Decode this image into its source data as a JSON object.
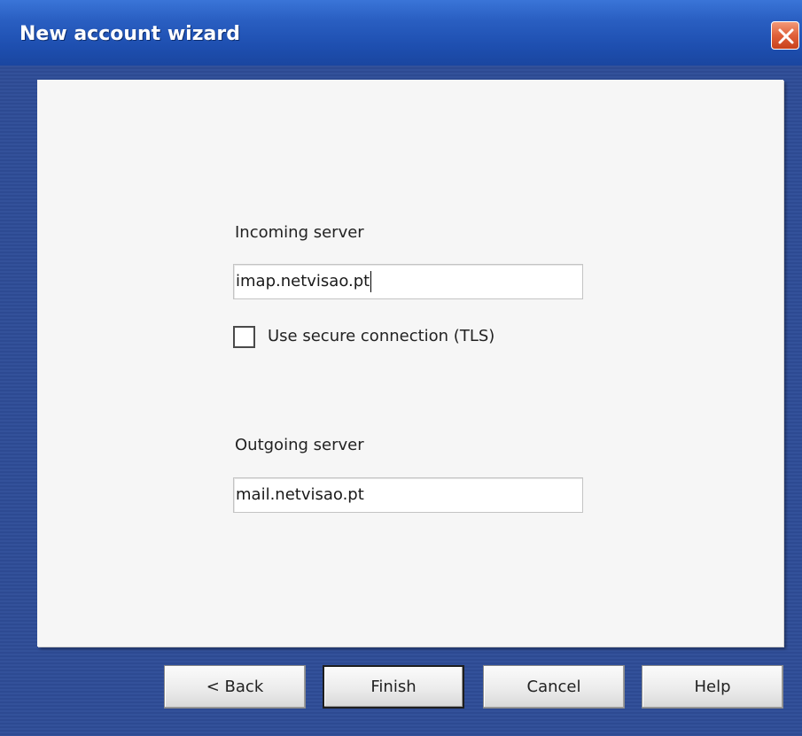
{
  "window": {
    "title": "New account wizard",
    "close_icon": "close-icon"
  },
  "form": {
    "incoming": {
      "label": "Incoming server",
      "value": "imap.netvisao.pt"
    },
    "secure": {
      "label": "Use secure connection (TLS)",
      "checked": false
    },
    "outgoing": {
      "label": "Outgoing server",
      "value": "mail.netvisao.pt"
    }
  },
  "buttons": {
    "back": "< Back",
    "finish": "Finish",
    "cancel": "Cancel",
    "help": "Help"
  },
  "colors": {
    "titlebar": "#2a5fc2",
    "close_button": "#e0603a",
    "frame": "#33519a",
    "panel": "#f6f6f6"
  }
}
